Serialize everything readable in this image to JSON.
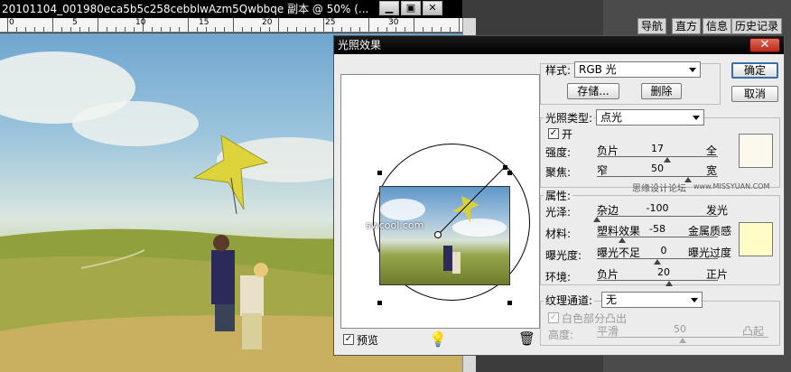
{
  "document": {
    "title": "20101104_001980eca5b5c258cebblwAzm5Qwbbqe 副本 @ 50% (...",
    "ruler_labels": [
      "0",
      "5",
      "10",
      "15",
      "20",
      "25",
      "30"
    ]
  },
  "panel": {
    "tabs": [
      "导航",
      "直方",
      "信息",
      "历史记录"
    ]
  },
  "dialog": {
    "title": "光照效果",
    "close": "✕",
    "style_label": "样式:",
    "style_value": "RGB 光",
    "save_label": "存储...",
    "delete_label": "删除",
    "ok_label": "确定",
    "cancel_label": "取消",
    "light_type_label": "光照类型:",
    "light_type_value": "点光",
    "on_label": "开",
    "intensity": {
      "label": "强度:",
      "left": "负片",
      "value": "17",
      "right": "全",
      "fraction": 0.58
    },
    "focus": {
      "label": "聚焦:",
      "left": "窄",
      "value": "50",
      "right": "宽",
      "fraction": 0.75
    },
    "light_color": "#fbf8ee",
    "properties_label": "属性:",
    "gloss": {
      "label": "光泽:",
      "left": "杂边",
      "value": "-100",
      "right": "发光",
      "fraction": 0.0
    },
    "material": {
      "label": "材料:",
      "left": "塑料效果",
      "value": "-58",
      "right": "金属质感",
      "fraction": 0.21
    },
    "exposure": {
      "label": "曝光度:",
      "left": "曝光不足",
      "value": "0",
      "right": "曝光过度",
      "fraction": 0.5
    },
    "ambience": {
      "label": "环境:",
      "left": "负片",
      "value": "20",
      "right": "正片",
      "fraction": 0.6
    },
    "ambient_color": "#fffcc6",
    "texture_channel_label": "纹理通道:",
    "texture_channel_value": "无",
    "white_high_label": "白色部分凸出",
    "height": {
      "label": "高度:",
      "left": "平滑",
      "value": "50",
      "right": "凸起",
      "fraction": 0.5
    },
    "preview_label": "预览",
    "watermark_left": "swcool.com",
    "watermark_right": "思缘设计论坛",
    "watermark_url": "www.MISSYUAN.COM"
  }
}
